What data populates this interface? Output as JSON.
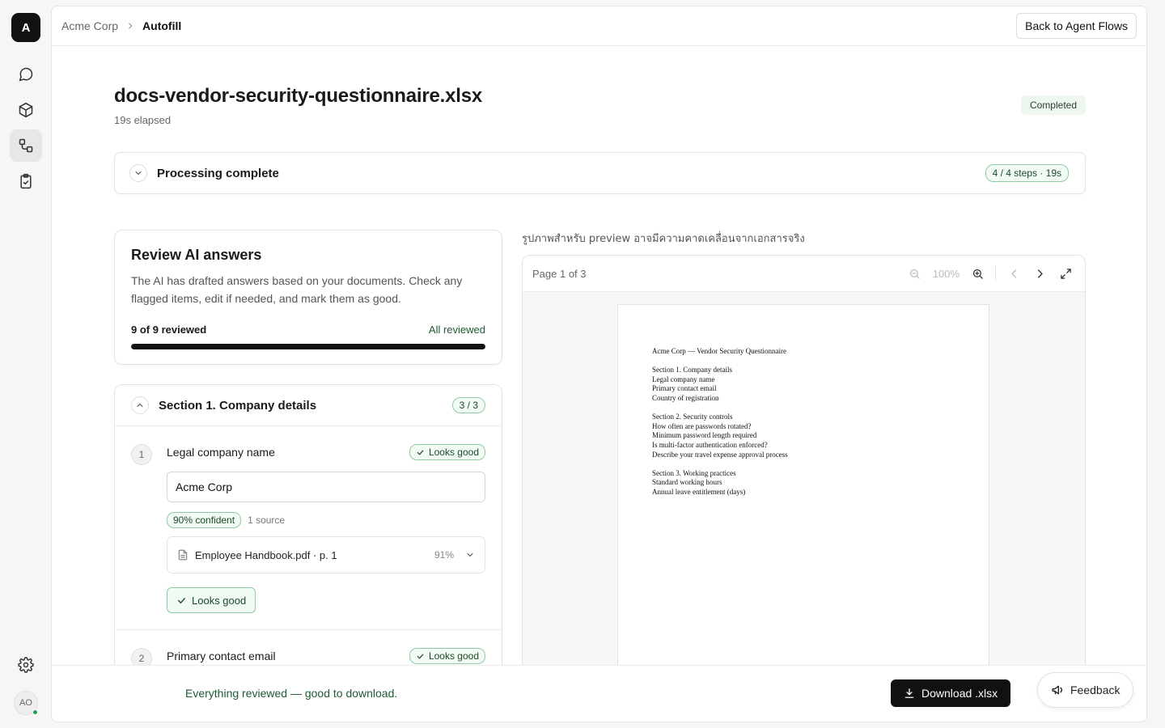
{
  "rail": {
    "logo": "A",
    "avatar": "AO",
    "items": [
      "chat-icon",
      "box-icon",
      "flows-icon",
      "clipboard-check-icon"
    ]
  },
  "breadcrumb": {
    "org": "Acme Corp",
    "page": "Autofill"
  },
  "header": {
    "back_label": "Back to Agent Flows"
  },
  "doc": {
    "title": "docs-vendor-security-questionnaire.xlsx",
    "elapsed": "19s elapsed",
    "status": "Completed"
  },
  "processing": {
    "label": "Processing complete",
    "steps": "4 / 4 steps · 19s"
  },
  "review": {
    "title": "Review AI answers",
    "description": "The AI has drafted answers based on your documents. Check any flagged items, edit if needed, and mark them as good.",
    "count": "9 of 9 reviewed",
    "status": "All reviewed",
    "progress": 1.0
  },
  "section1": {
    "title": "Section 1. Company details",
    "count": "3 / 3",
    "questions": [
      {
        "num": "1",
        "title": "Legal company name",
        "status": "Looks good",
        "answer": "Acme Corp",
        "confidence": "90% confident",
        "sources": "1 source",
        "source_name": "Employee Handbook.pdf · p. 1",
        "source_pct": "91%",
        "mark_label": "Looks good"
      },
      {
        "num": "2",
        "title": "Primary contact email",
        "status": "Looks good"
      }
    ]
  },
  "preview": {
    "label": "รูปภาพสำหรับ preview อาจมีความคาดเคลื่อนจากเอกสารจริง",
    "page": "Page 1 of 3",
    "zoom": "100%",
    "lines": [
      "Acme Corp — Vendor Security Questionnaire",
      "",
      "Section 1. Company details",
      "Legal company name",
      "Primary contact email",
      "Country of registration",
      "",
      "Section 2. Security controls",
      "How often are passwords rotated?",
      "Minimum password length required",
      "Is multi-factor authentication enforced?",
      "Describe your travel expense approval process",
      "",
      "Section 3. Working practices",
      "Standard working hours",
      "Annual leave entitlement (days)"
    ]
  },
  "footer": {
    "message": "Everything reviewed — good to download.",
    "download_label": "Download .xlsx",
    "feedback_label": "Feedback"
  }
}
